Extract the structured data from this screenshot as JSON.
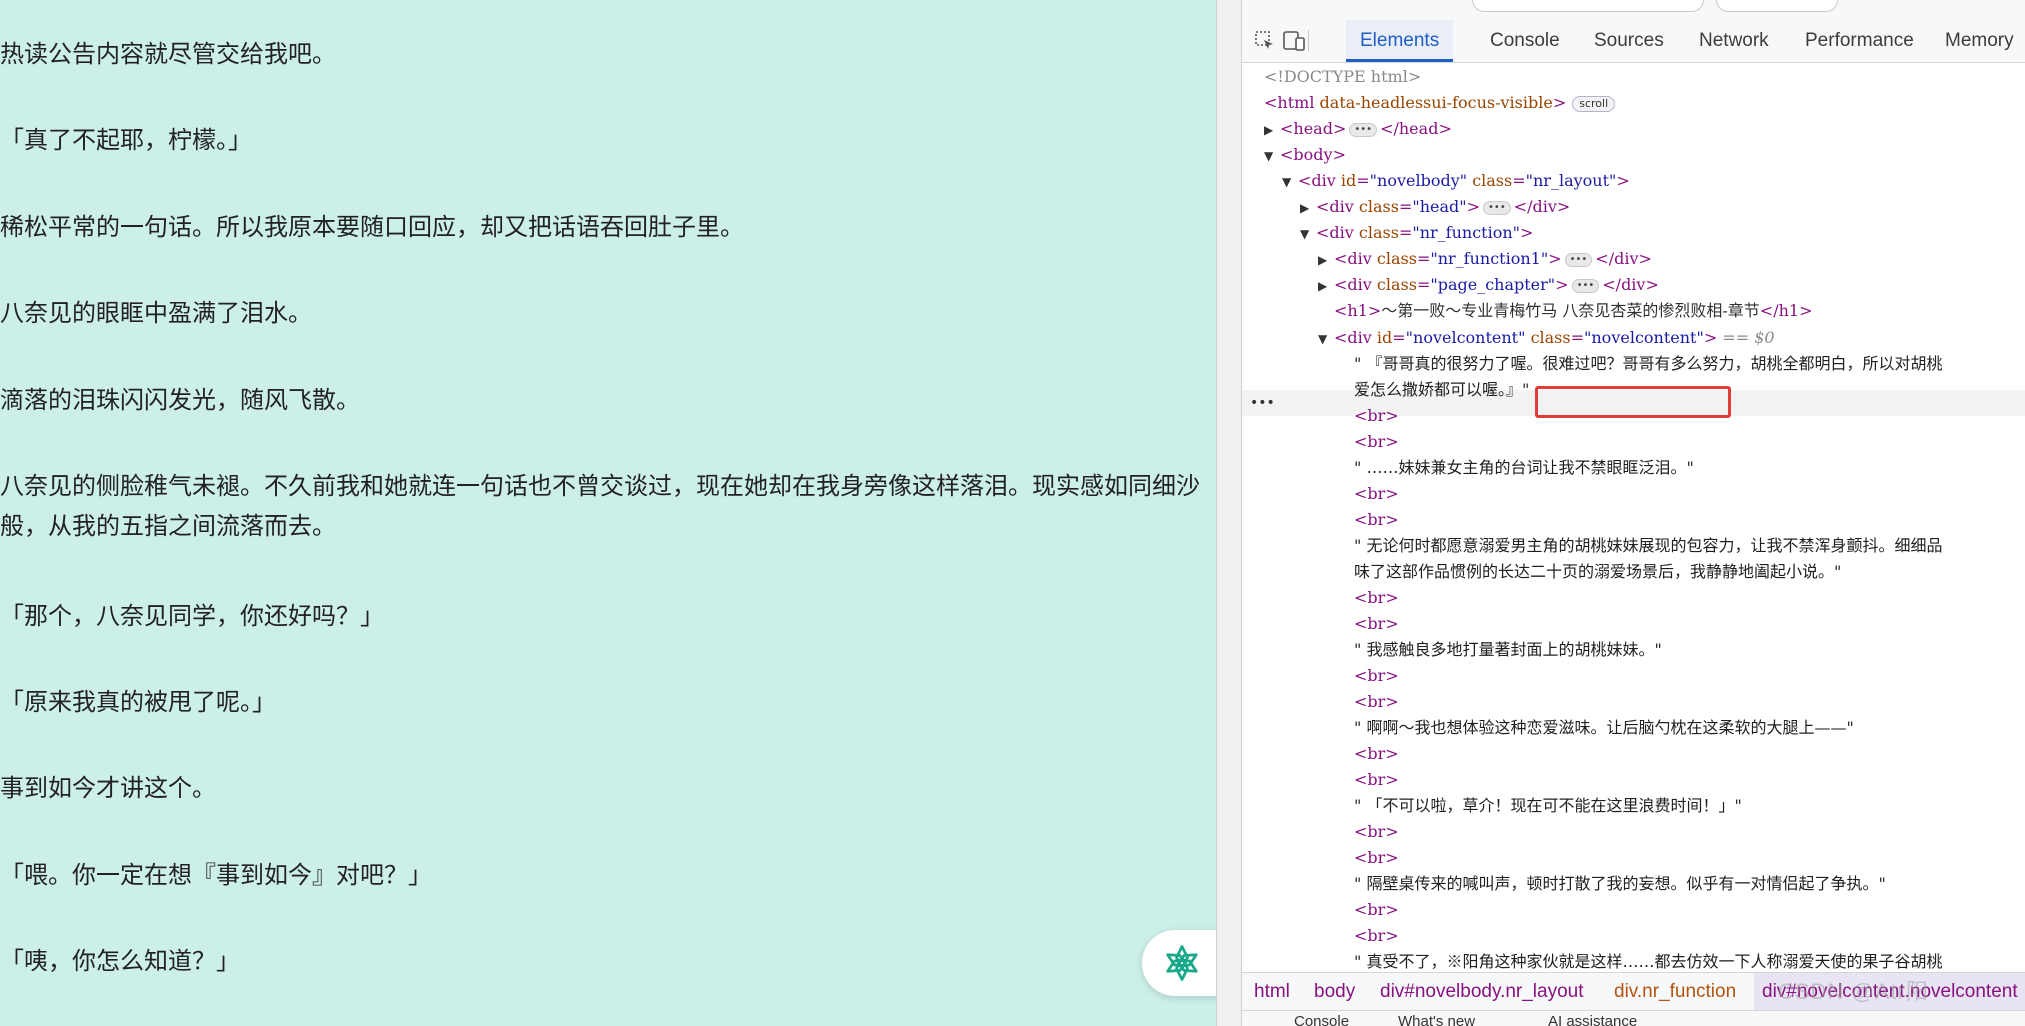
{
  "reader": {
    "paragraphs": [
      "热读公告内容就尽管交给我吧。",
      "「真了不起耶，柠檬。」",
      "稀松平常的一句话。所以我原本要随口回应，却又把话语吞回肚子里。",
      "八奈见的眼眶中盈满了泪水。",
      "滴落的泪珠闪闪发光，随风飞散。",
      "八奈见的侧脸稚气未褪。不久前我和她就连一句话也不曾交谈过，现在她却在我身旁像这样落泪。现实感如同细沙\n般，从我的五指之间流落而去。",
      "「那个，八奈见同学，你还好吗？」",
      "「原来我真的被甩了呢。」",
      "事到如今才讲这个。",
      "「喂。你一定在想『事到如今』对吧？」",
      "「咦，你怎么知道？」"
    ],
    "ai_button_icon": "ai-assistant-icon"
  },
  "devtools": {
    "toolbar": {
      "inspect_icon": "inspect-element-icon",
      "device_icon": "device-toolbar-icon",
      "tabs": [
        "Elements",
        "Console",
        "Sources",
        "Network",
        "Performance",
        "Memory"
      ],
      "active_tab": "Elements"
    },
    "tree": {
      "doctype": "<!DOCTYPE html>",
      "html_tag": "html",
      "html_attr": "data-headlessui-focus-visible",
      "scroll_badge": "scroll",
      "head_tag": "head",
      "body_tag": "body",
      "novelbody_id": "novelbody",
      "novelbody_class": "nr_layout",
      "head_div_class": "head",
      "nr_function_class": "nr_function",
      "nr_function1_class": "nr_function1",
      "page_chapter_class": "page_chapter",
      "h1_text": "～第一败～专业青梅竹马 八奈见杏菜的惨烈败相-章节",
      "novelcontent_id": "novelcontent",
      "novelcontent_class": "novelcontent",
      "selected_marker": "== $0",
      "text_nodes": [
        "\" 『哥哥真的很努力了喔。很难过吧？哥哥有多么努力，胡桃全都明白，所以对胡桃",
        "爱怎么撒娇都可以喔。』\"",
        "\" ……妹妹兼女主角的台词让我不禁眼眶泛泪。\"",
        "\" 无论何时都愿意溺爱男主角的胡桃妹妹展现的包容力，让我不禁浑身颤抖。细细品",
        "味了这部作品惯例的长达二十页的溺爱场景后，我静静地阖起小说。\"",
        "\" 我感触良多地打量著封面上的胡桃妹妹。\"",
        "\" 啊啊～我也想体验这种恋爱滋味。让后脑勺枕在这柔软的大腿上——\"",
        "\" 「不可以啦，草介！现在可不能在这里浪费时间！」\"",
        "\" 隔壁桌传来的喊叫声，顿时打散了我的妄想。似乎有一对情侣起了争执。\"",
        "\" 真受不了，※阳角这种家伙就是这样……都去仿效一下人称溺爱天使的果子谷胡桃"
      ],
      "br": "br"
    },
    "breadcrumb": [
      "html",
      "body",
      "div#novelbody.nr_layout",
      "div.nr_function",
      "div#novelcontent.novelcontent"
    ],
    "watermark": "CSDN @Atr阳",
    "drawer": {
      "items": [
        "Console",
        "What's new",
        "AI assistance"
      ]
    }
  }
}
